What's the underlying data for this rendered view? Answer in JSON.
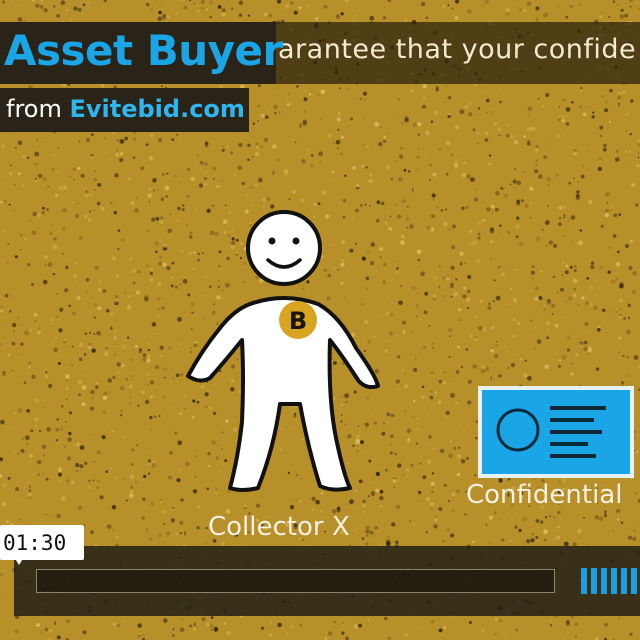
{
  "brand": {
    "title": "Asset Buyer",
    "from_prefix": "from ",
    "domain": "Evitebid.com",
    "title_color": "#1aa6e6"
  },
  "caption": {
    "text": "arantee that your confide"
  },
  "scene": {
    "figure_label": "Collector X",
    "badge_letter": "B",
    "card_label": "Confidential",
    "card_color": "#1aa6e6",
    "badge_color": "#d9a41f"
  },
  "player": {
    "time": "01:30",
    "accent_color": "#1a9fe0",
    "volume_level": 1.0
  }
}
